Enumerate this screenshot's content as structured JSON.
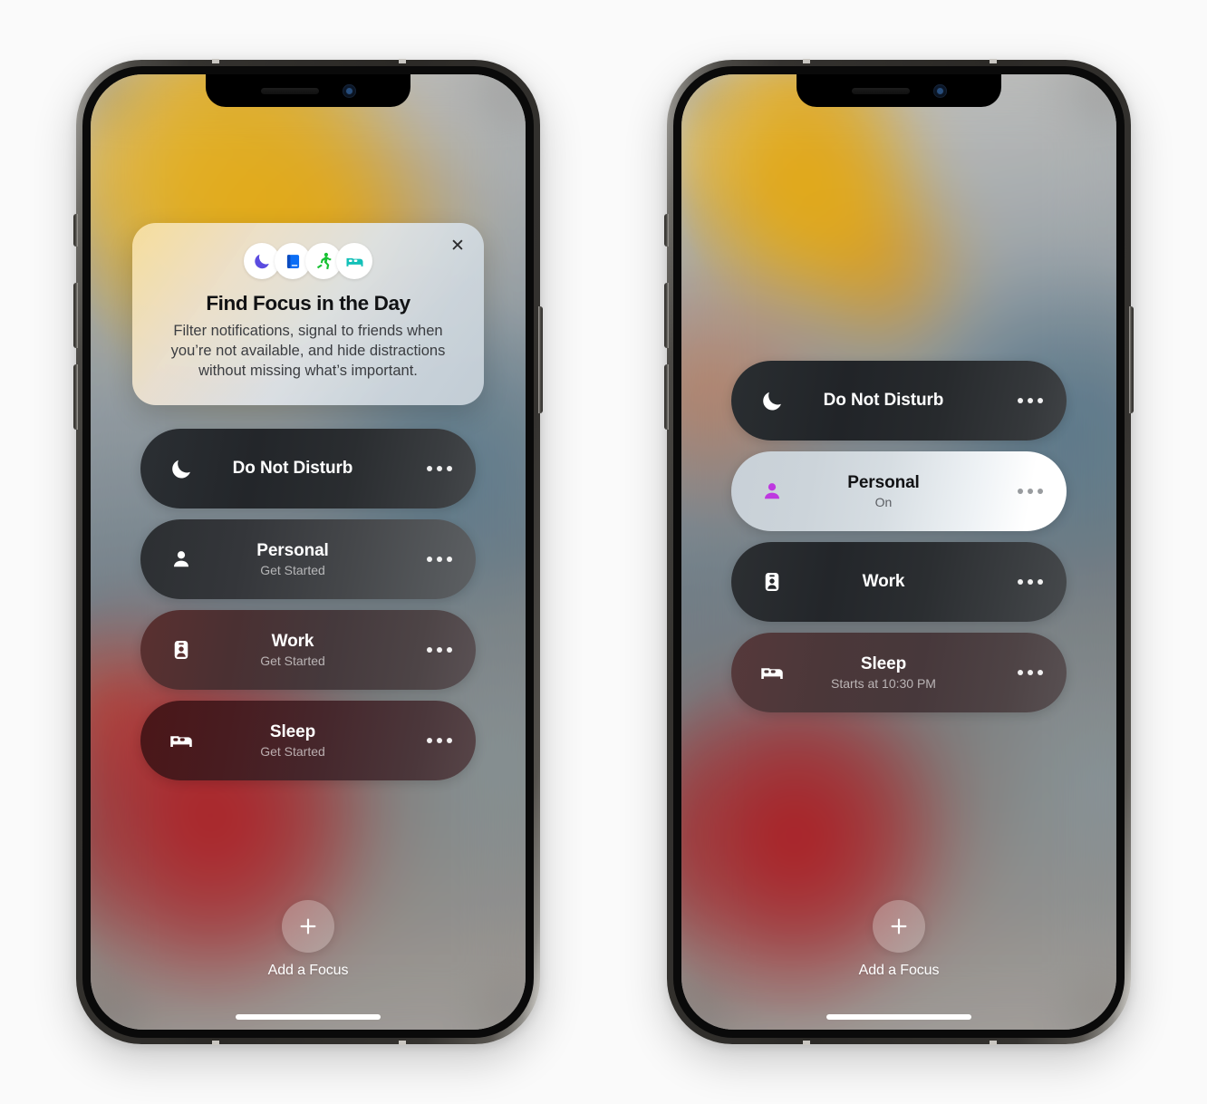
{
  "page": {
    "background_color": "#fafafa",
    "device_count": 2
  },
  "promo_card": {
    "title": "Find Focus in the Day",
    "body": "Filter notifications, signal to friends when you’re not available, and hide distractions without missing what’s important.",
    "close_label": "✕",
    "icons": [
      {
        "name": "crescent-moon-icon",
        "color": "#5B4CE0"
      },
      {
        "name": "book-icon",
        "color": "#0B6EF5"
      },
      {
        "name": "running-person-icon",
        "color": "#18C233"
      },
      {
        "name": "bed-icon",
        "color": "#12C0B8"
      }
    ]
  },
  "phone_left": {
    "focus_rows": [
      {
        "id": "do-not-disturb",
        "title": "Do Not Disturb",
        "subtitle": "",
        "icon": "crescent-moon-icon",
        "active": false,
        "more_label": "•••"
      },
      {
        "id": "personal",
        "title": "Personal",
        "subtitle": "Get Started",
        "icon": "person-icon",
        "active": false,
        "more_label": "•••"
      },
      {
        "id": "work",
        "title": "Work",
        "subtitle": "Get Started",
        "icon": "id-badge-icon",
        "active": false,
        "more_label": "•••"
      },
      {
        "id": "sleep",
        "title": "Sleep",
        "subtitle": "Get Started",
        "icon": "bed-icon",
        "active": false,
        "more_label": "•••"
      }
    ],
    "add_focus": {
      "label": "Add a Focus",
      "icon": "plus-icon"
    }
  },
  "phone_right": {
    "focus_rows": [
      {
        "id": "do-not-disturb",
        "title": "Do Not Disturb",
        "subtitle": "",
        "icon": "crescent-moon-icon",
        "active": false,
        "more_label": "•••"
      },
      {
        "id": "personal",
        "title": "Personal",
        "subtitle": "On",
        "icon": "person-icon",
        "active": true,
        "accent_color": "#BE38E0",
        "more_label": "•••"
      },
      {
        "id": "work",
        "title": "Work",
        "subtitle": "",
        "icon": "id-badge-icon",
        "active": false,
        "more_label": "•••"
      },
      {
        "id": "sleep",
        "title": "Sleep",
        "subtitle": "Starts at 10:30 PM",
        "icon": "bed-icon",
        "active": false,
        "more_label": "•••"
      }
    ],
    "add_focus": {
      "label": "Add a Focus",
      "icon": "plus-icon"
    }
  }
}
